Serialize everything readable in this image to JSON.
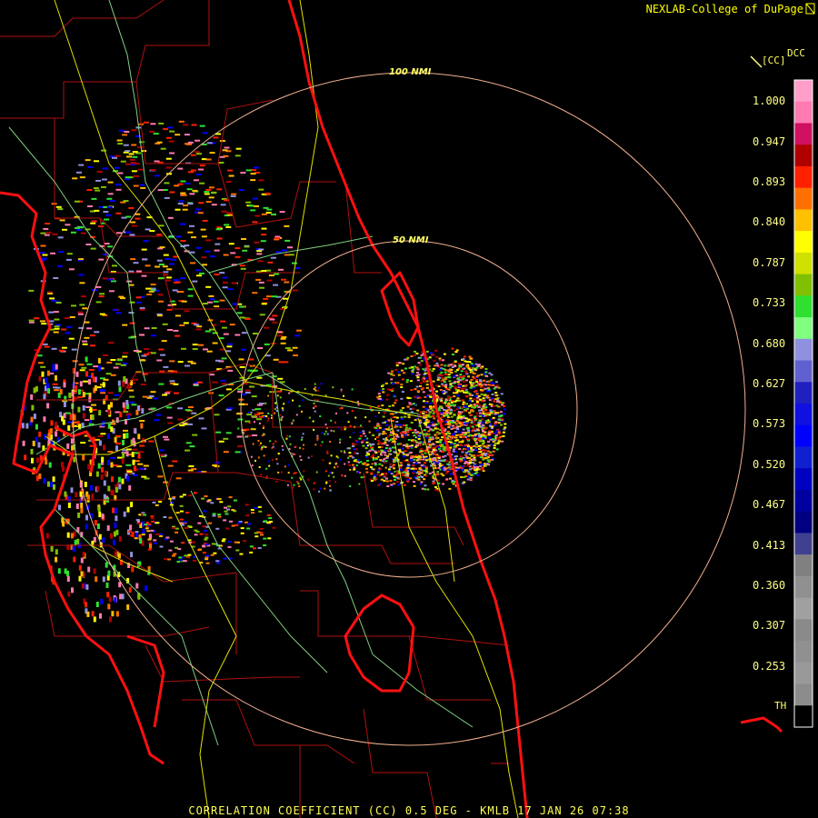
{
  "credit": "NEXLAB-College of DuPage",
  "footer": "CORRELATION COEFFICIENT (CC) 0.5 DEG - KMLB 17 JAN 26 07:38",
  "legend": {
    "name": "DCC",
    "unit": "[CC]",
    "threshold_label": "TH",
    "ticks": [
      "1.000",
      "0.947",
      "0.893",
      "0.840",
      "0.787",
      "0.733",
      "0.680",
      "0.627",
      "0.573",
      "0.520",
      "0.467",
      "0.413",
      "0.360",
      "0.307",
      "0.253"
    ]
  },
  "range_rings": [
    {
      "label": "100 NMI"
    },
    {
      "label": "50 NMI"
    }
  ],
  "colors": {
    "background": "#000000",
    "county_lines": "#b01010",
    "coastline": "#ff1010",
    "roads_yellow": "#e0e000",
    "roads_green": "#80d080",
    "range_ring": "#f0b090",
    "text": "#ffff66"
  },
  "icons": [
    "corner-logo-icon",
    "diagonal-slash-icon"
  ]
}
